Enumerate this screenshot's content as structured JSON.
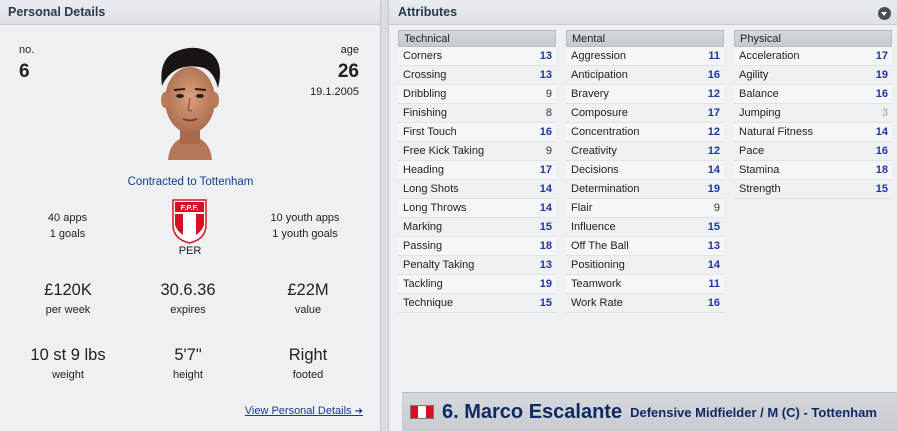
{
  "left_panel": {
    "header": "Personal Details",
    "number_label": "no.",
    "number": "6",
    "age_label": "age",
    "age": "26",
    "birth_date": "19.1.2005",
    "contract": "Contracted to Tottenham",
    "apps": "40 apps",
    "goals": "1 goals",
    "youth_apps": "10 youth apps",
    "youth_goals": "1 youth goals",
    "nation_badge_text": "F.P.F.",
    "nation_code": "PER",
    "wage": "£120K",
    "wage_label": "per week",
    "expires": "30.6.36",
    "expires_label": "expires",
    "value": "£22M",
    "value_label": "value",
    "weight": "10 st 9 lbs",
    "weight_label": "weight",
    "height": "5'7\"",
    "height_label": "height",
    "footed": "Right",
    "footed_label": "footed",
    "view_link": "View Personal Details",
    "view_link_icon": "arrow-right-icon"
  },
  "right_panel": {
    "header": "Attributes",
    "collapse_icon": "chevron-down-icon",
    "technical": {
      "title": "Technical",
      "rows": [
        {
          "name": "Corners",
          "value": "13"
        },
        {
          "name": "Crossing",
          "value": "13"
        },
        {
          "name": "Dribbling",
          "value": "9"
        },
        {
          "name": "Finishing",
          "value": "8"
        },
        {
          "name": "First Touch",
          "value": "16"
        },
        {
          "name": "Free Kick Taking",
          "value": "9"
        },
        {
          "name": "Heading",
          "value": "17"
        },
        {
          "name": "Long Shots",
          "value": "14"
        },
        {
          "name": "Long Throws",
          "value": "14"
        },
        {
          "name": "Marking",
          "value": "15"
        },
        {
          "name": "Passing",
          "value": "18"
        },
        {
          "name": "Penalty Taking",
          "value": "13"
        },
        {
          "name": "Tackling",
          "value": "19"
        },
        {
          "name": "Technique",
          "value": "15"
        }
      ]
    },
    "mental": {
      "title": "Mental",
      "rows": [
        {
          "name": "Aggression",
          "value": "11"
        },
        {
          "name": "Anticipation",
          "value": "16"
        },
        {
          "name": "Bravery",
          "value": "12"
        },
        {
          "name": "Composure",
          "value": "17"
        },
        {
          "name": "Concentration",
          "value": "12"
        },
        {
          "name": "Creativity",
          "value": "12"
        },
        {
          "name": "Decisions",
          "value": "14"
        },
        {
          "name": "Determination",
          "value": "19"
        },
        {
          "name": "Flair",
          "value": "9"
        },
        {
          "name": "Influence",
          "value": "15"
        },
        {
          "name": "Off The Ball",
          "value": "13"
        },
        {
          "name": "Positioning",
          "value": "14"
        },
        {
          "name": "Teamwork",
          "value": "11"
        },
        {
          "name": "Work Rate",
          "value": "16"
        }
      ]
    },
    "physical": {
      "title": "Physical",
      "rows": [
        {
          "name": "Acceleration",
          "value": "17"
        },
        {
          "name": "Agility",
          "value": "19"
        },
        {
          "name": "Balance",
          "value": "16"
        },
        {
          "name": "Jumping",
          "value": "3"
        },
        {
          "name": "Natural Fitness",
          "value": "14"
        },
        {
          "name": "Pace",
          "value": "16"
        },
        {
          "name": "Stamina",
          "value": "18"
        },
        {
          "name": "Strength",
          "value": "15"
        }
      ]
    }
  },
  "namebar": {
    "player_name": "6. Marco Escalante",
    "position": "Defensive Midfielder / M (C) - Tottenham"
  },
  "colors": {
    "peru_red": "#d91023",
    "link_blue": "#1a3a8e",
    "high_value": "#1a37a8",
    "low_value": "#9a9a9a"
  }
}
